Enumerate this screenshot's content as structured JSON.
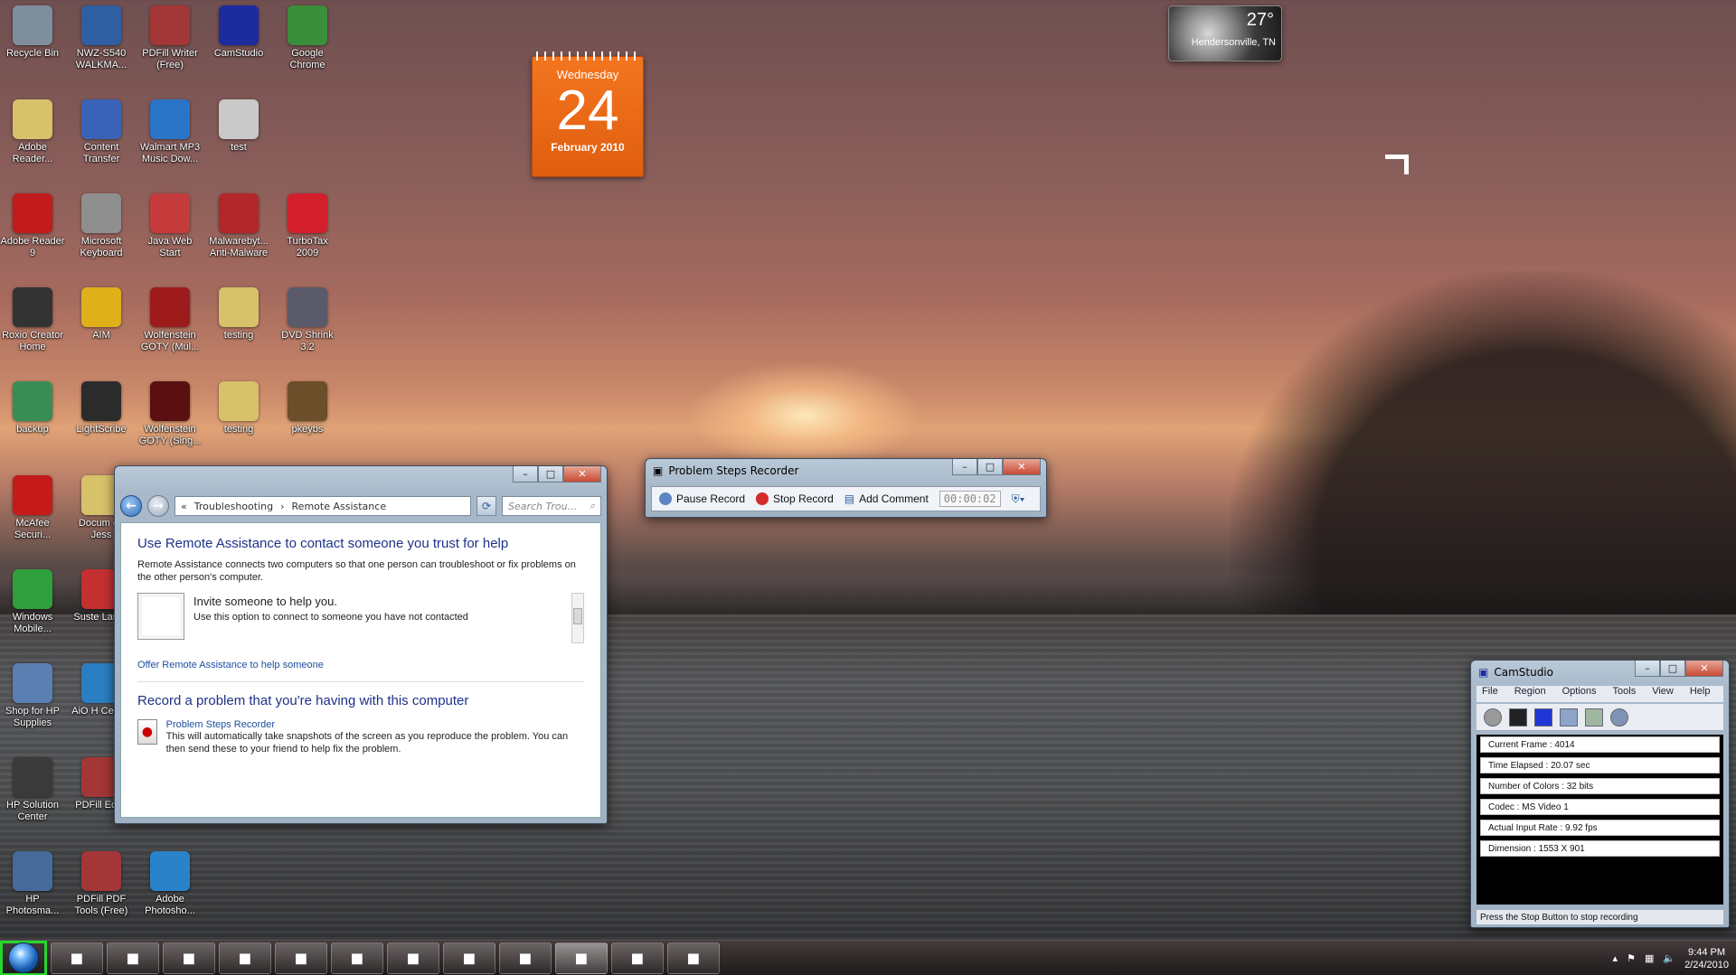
{
  "desktop_icons": [
    {
      "label": "Recycle Bin",
      "icon": "recycle-bin-icon",
      "color": "#7f8e9c"
    },
    {
      "label": "NWZ-S540 WALKMA...",
      "icon": "walkman-icon",
      "color": "#2f5ea3"
    },
    {
      "label": "PDFill Writer (Free)",
      "icon": "pdf-writer-icon",
      "color": "#a33636"
    },
    {
      "label": "CamStudio",
      "icon": "camstudio-icon",
      "color": "#1c2b9e"
    },
    {
      "label": "Google Chrome",
      "icon": "chrome-icon",
      "color": "#3b8e3b"
    },
    {
      "label": "Adobe Reader...",
      "icon": "folder-icon",
      "color": "#d8c16b"
    },
    {
      "label": "Content Transfer",
      "icon": "content-transfer-icon",
      "color": "#3a63b8"
    },
    {
      "label": "Walmart MP3 Music Dow...",
      "icon": "walmart-icon",
      "color": "#2a74c8"
    },
    {
      "label": "test",
      "icon": "document-icon",
      "color": "#c9c9c9"
    },
    {
      "label": "Adobe Reader 9",
      "icon": "adobe-reader-icon",
      "color": "#c21b1b"
    },
    {
      "label": "Microsoft Keyboard",
      "icon": "keyboard-icon",
      "color": "#8f8f8f"
    },
    {
      "label": "Java Web Start",
      "icon": "java-icon",
      "color": "#c53b3b"
    },
    {
      "label": "Malwarebyt... Anti-Malware",
      "icon": "malwarebytes-icon",
      "color": "#b3262a"
    },
    {
      "label": "TurboTax 2009",
      "icon": "turbotax-icon",
      "color": "#d31f2c"
    },
    {
      "label": "Roxio Creator Home",
      "icon": "roxio-icon",
      "color": "#333333"
    },
    {
      "label": "AIM",
      "icon": "aim-icon",
      "color": "#e0b01a"
    },
    {
      "label": "Wolfenstein GOTY (Mul...",
      "icon": "wolfenstein-icon",
      "color": "#9e1b1b"
    },
    {
      "label": "testing",
      "icon": "folder-icon",
      "color": "#d8c16b"
    },
    {
      "label": "DVD Shrink 3.2",
      "icon": "dvd-shrink-icon",
      "color": "#5a5a6a"
    },
    {
      "label": "backup",
      "icon": "backup-icon",
      "color": "#3a8c55"
    },
    {
      "label": "LightScribe",
      "icon": "lightscribe-icon",
      "color": "#2b2b2b"
    },
    {
      "label": "Wolfenstein GOTY (Sing...",
      "icon": "wolfenstein-icon",
      "color": "#5a1010"
    },
    {
      "label": "testing",
      "icon": "folder-icon",
      "color": "#d8c16b"
    },
    {
      "label": "pkeybs",
      "icon": "pkeybs-icon",
      "color": "#6b4e2a"
    },
    {
      "label": "McAfee Securi...",
      "icon": "mcafee-icon",
      "color": "#c41a1a"
    },
    {
      "label": "Docum on Jess",
      "icon": "folder-icon",
      "color": "#d8c16b"
    },
    {
      "label": "Windows Mobile...",
      "icon": "windows-mobile-icon",
      "color": "#2f9e3c"
    },
    {
      "label": "Suste Launc",
      "icon": "sustem-launcher-icon",
      "color": "#c43030"
    },
    {
      "label": "Shop for HP Supplies",
      "icon": "hp-supplies-icon",
      "color": "#5b7fb0"
    },
    {
      "label": "AiO H Center",
      "icon": "aio-center-icon",
      "color": "#2a7ec2"
    },
    {
      "label": "HP Solution Center",
      "icon": "hp-solution-center-icon",
      "color": "#3a3a3a"
    },
    {
      "label": "PDFill Edito",
      "icon": "pdfill-editor-icon",
      "color": "#a33636"
    },
    {
      "label": "HP Photosma...",
      "icon": "hp-photosmart-icon",
      "color": "#466a9a"
    },
    {
      "label": "PDFill PDF Tools (Free)",
      "icon": "pdfill-tools-icon",
      "color": "#a33636"
    },
    {
      "label": "Adobe Photosho...",
      "icon": "photoshop-elements-icon",
      "color": "#2a83c9"
    }
  ],
  "calendar": {
    "weekday": "Wednesday",
    "day": "24",
    "month": "February 2010"
  },
  "weather": {
    "temp": "27°",
    "city": "Hendersonville, TN"
  },
  "control_panel": {
    "breadcrumb": [
      "«",
      "Troubleshooting",
      "›",
      "Remote Assistance"
    ],
    "search_placeholder": "Search Trou...",
    "heading": "Use Remote Assistance to contact someone you trust for help",
    "description": "Remote Assistance connects two computers so that one person can troubleshoot or fix problems on the other person's computer.",
    "invite_title": "Invite someone to help you.",
    "invite_desc": "Use this option to connect to someone you have not contacted",
    "offer_link": "Offer Remote Assistance to help someone",
    "record_heading": "Record a problem that you're having with this computer",
    "psr_link": "Problem Steps Recorder",
    "psr_desc": "This will automatically take snapshots of the screen as you reproduce the problem. You can then send these to your friend to help fix the problem."
  },
  "psr": {
    "title": "Problem Steps Recorder",
    "pause": "Pause Record",
    "stop": "Stop Record",
    "comment": "Add Comment",
    "timer": "00:00:02"
  },
  "camstudio": {
    "title": "CamStudio",
    "menu": [
      "File",
      "Region",
      "Options",
      "Tools",
      "View",
      "Help"
    ],
    "stats": [
      "Current Frame : 4014",
      "Time Elapsed : 20.07 sec",
      "Number of Colors : 32 bits",
      "Codec : MS Video 1",
      "Actual Input Rate : 9.92 fps",
      "Dimension : 1553 X 901"
    ],
    "status": "Press the Stop Button to stop recording"
  },
  "taskbar": {
    "items": [
      {
        "icon": "internet-explorer-icon"
      },
      {
        "icon": "file-explorer-icon"
      },
      {
        "icon": "media-player-icon"
      },
      {
        "icon": "outlook-icon"
      },
      {
        "icon": "folder-icon"
      },
      {
        "icon": "excel-icon"
      },
      {
        "icon": "aim-icon"
      },
      {
        "icon": "notepad-icon"
      },
      {
        "icon": "tools-icon"
      },
      {
        "icon": "camstudio-icon"
      },
      {
        "icon": "remote-desktop-icon"
      },
      {
        "icon": "problem-steps-recorder-icon"
      }
    ],
    "time": "9:44 PM",
    "date": "2/24/2010"
  }
}
